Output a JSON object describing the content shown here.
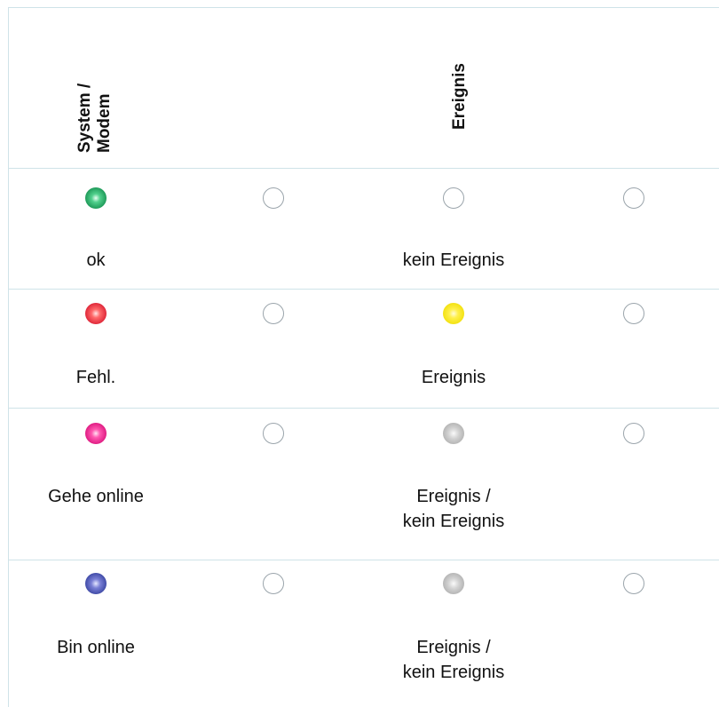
{
  "header": {
    "col_system": "System /\nModem",
    "col_event": "Ereignis"
  },
  "rows": [
    {
      "system_led": "green",
      "event_led": "off",
      "system_label": "ok",
      "event_label": "kein Ereignis"
    },
    {
      "system_led": "red",
      "event_led": "yellow",
      "system_label": "Fehl.",
      "event_label": "Ereignis"
    },
    {
      "system_led": "magenta",
      "event_led": "gray",
      "system_label": "Gehe online",
      "event_label": "Ereignis /\nkein Ereignis"
    },
    {
      "system_led": "blue",
      "event_led": "gray",
      "system_label": "Bin online",
      "event_label": "Ereignis /\nkein Ereignis"
    }
  ],
  "colors": {
    "grid_line": "#cfe3e8",
    "led_off_border": "#9aa4ab"
  }
}
